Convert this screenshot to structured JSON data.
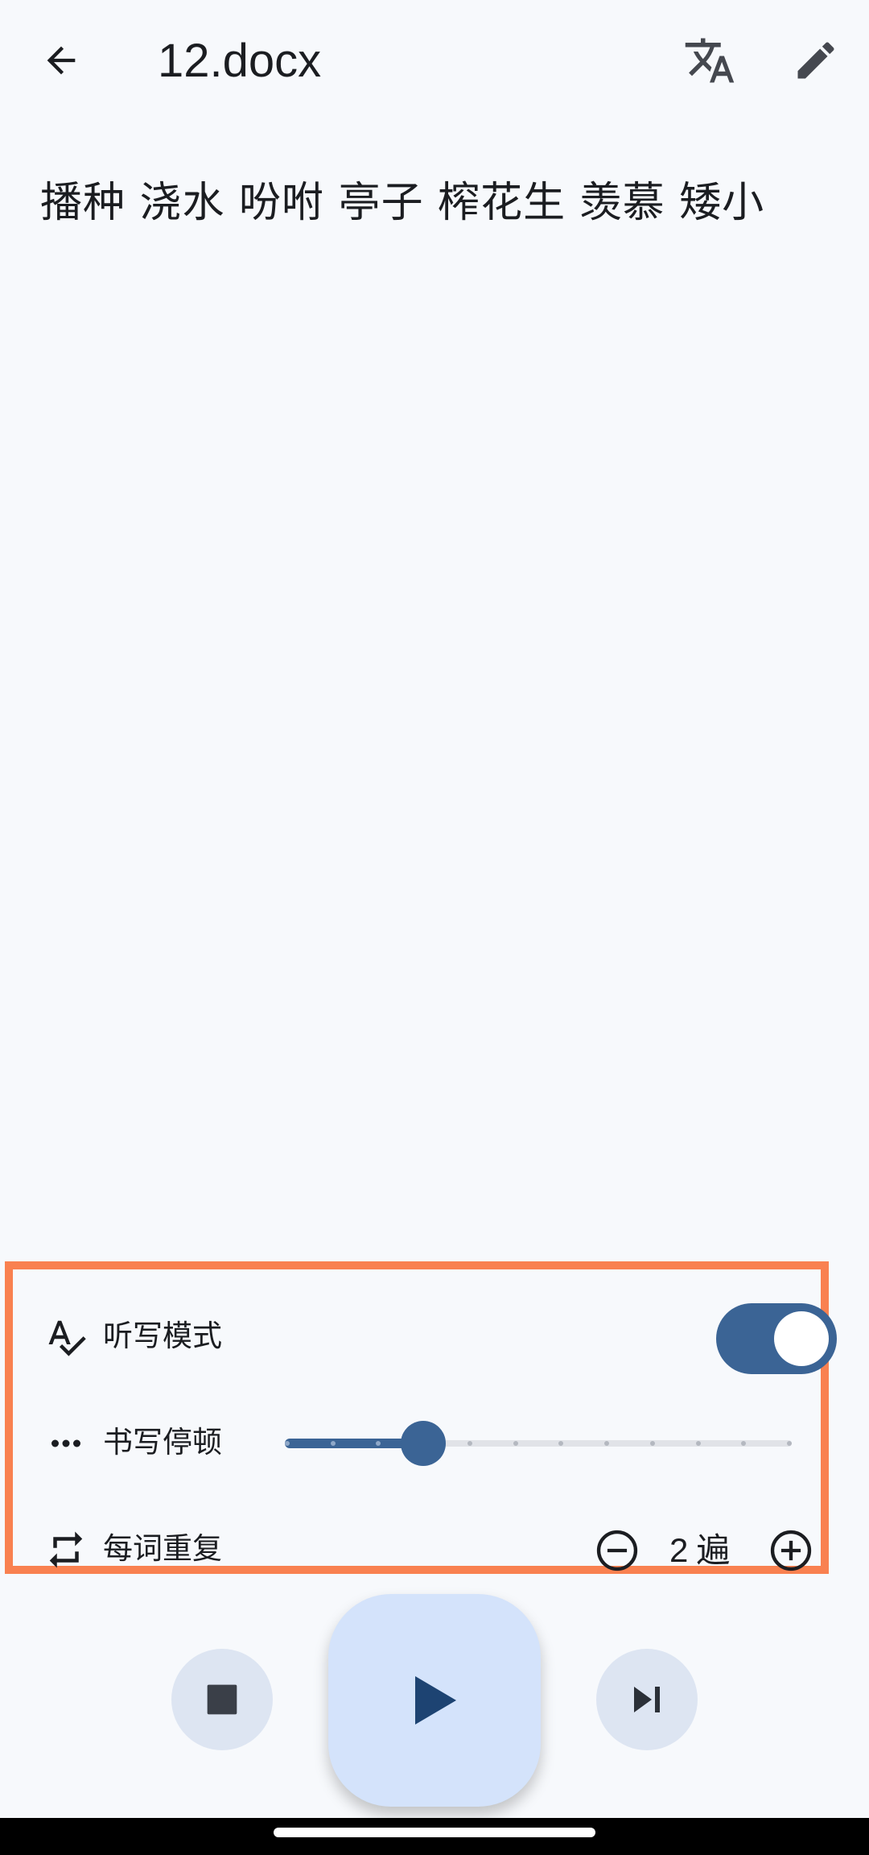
{
  "header": {
    "title": "12.docx",
    "icons": {
      "back": "arrow-back-icon",
      "translate": "translate-icon",
      "edit": "edit-pencil-icon"
    }
  },
  "content": {
    "text": "播种 浇水 吩咐 亭子 榨花生 羡慕 矮小"
  },
  "settings": {
    "dictation_mode": {
      "label": "听写模式",
      "icon": "spellcheck-icon",
      "enabled": true
    },
    "writing_pause": {
      "label": "书写停顿",
      "icon": "more-horiz-icon",
      "steps": 12,
      "value_step": 3,
      "value_fraction": 0.2727
    },
    "repeat_per_word": {
      "label": "每词重复",
      "icon": "repeat-icon",
      "count": "2",
      "unit": "遍"
    }
  },
  "playback": {
    "stop_icon": "stop-icon",
    "play_icon": "play-icon",
    "next_icon": "skip-next-icon"
  },
  "colors": {
    "accent": "#3b6495",
    "highlight_border": "#f98150",
    "play_button_bg": "#d4e3fb",
    "round_button_bg": "#dde5f2",
    "background": "#f7f9fc"
  }
}
